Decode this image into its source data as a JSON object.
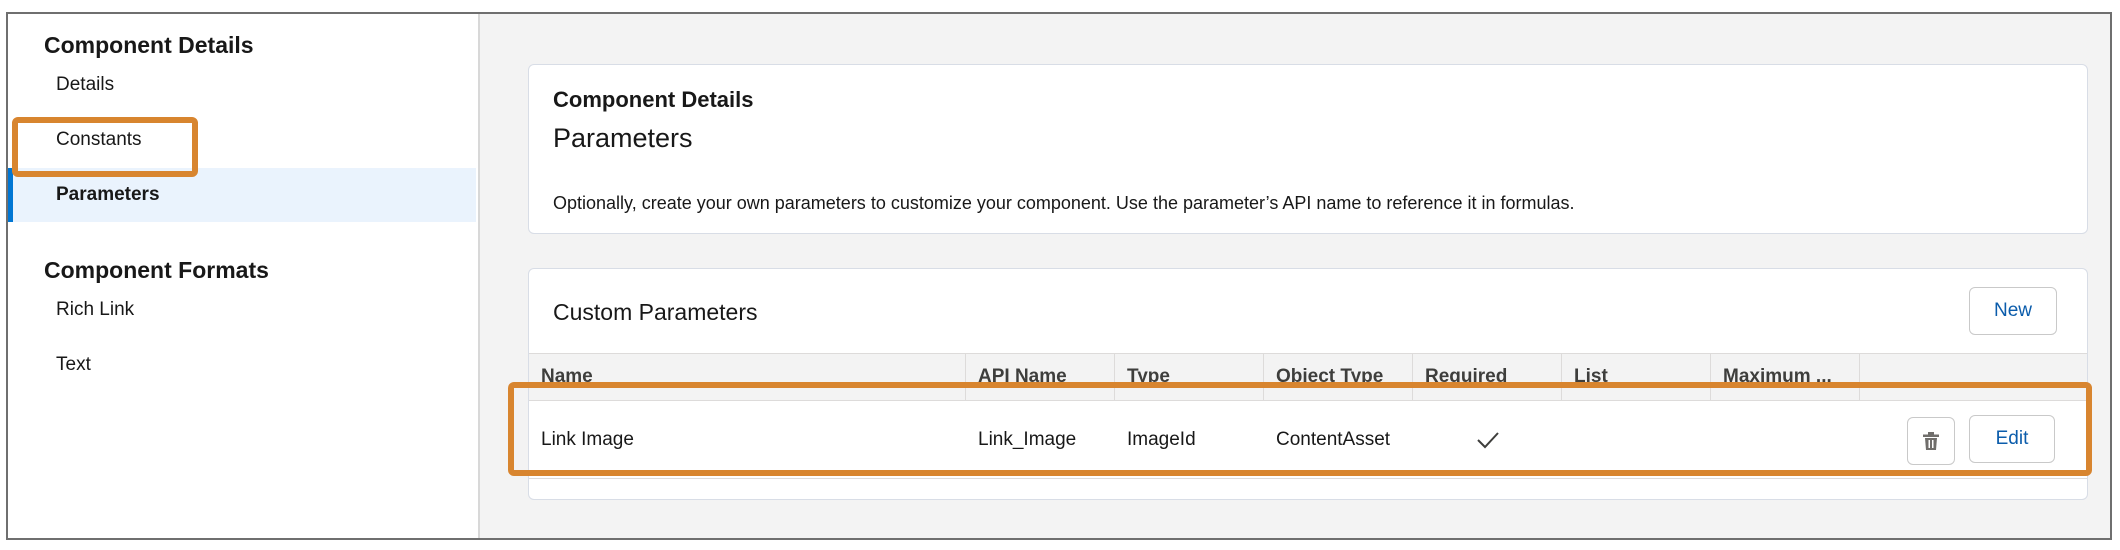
{
  "sidebar": {
    "section1_title": "Component Details",
    "section1_items": [
      {
        "label": "Details"
      },
      {
        "label": "Constants"
      },
      {
        "label": "Parameters"
      }
    ],
    "section2_title": "Component Formats",
    "section2_items": [
      {
        "label": "Rich Link"
      },
      {
        "label": "Text"
      }
    ],
    "active_item": "Parameters"
  },
  "details_card": {
    "heading": "Component Details",
    "title": "Parameters",
    "description": "Optionally, create your own parameters to customize your component. Use the parameter’s API name to reference it in formulas."
  },
  "params_card": {
    "title": "Custom Parameters",
    "new_button": "New",
    "columns": [
      "Name",
      "API Name",
      "Type",
      "Object Type",
      "Required",
      "List",
      "Maximum ..."
    ],
    "rows": [
      {
        "name": "Link Image",
        "api_name": "Link_Image",
        "type": "ImageId",
        "object_type": "ContentAsset",
        "required": "✓",
        "list": "",
        "maximum": "",
        "delete_icon": "trash-icon",
        "edit_button": "Edit"
      }
    ]
  },
  "colors": {
    "highlight": "#d8852f",
    "accent": "#0176d3",
    "link_text": "#0b5cab",
    "active_bg": "#eaf3fd"
  }
}
